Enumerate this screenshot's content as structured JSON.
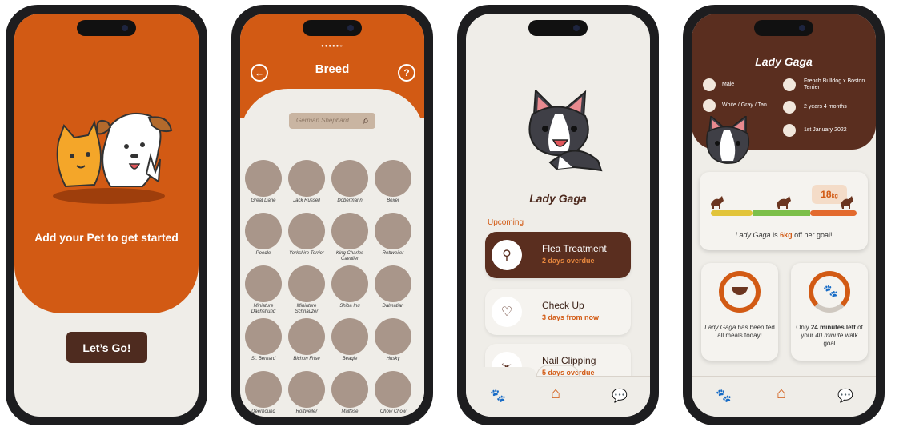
{
  "screen1": {
    "headline": "Add your Pet to get started",
    "cta_label": "Let’s Go!"
  },
  "screen2": {
    "pager": "●●●●●○",
    "title": "Breed",
    "back_icon": "arrow-left-icon",
    "help_icon": "question-icon",
    "help_glyph": "?",
    "back_glyph": "←",
    "search_placeholder": "German Shephard",
    "search_glyph": "⌕",
    "breeds": [
      "Great Dane",
      "Jack Russell",
      "Dobermann",
      "Boxer",
      "Poodle",
      "Yorkshire Terrier",
      "King Charles Cavalier",
      "Rottweiler",
      "Miniature Dachshund",
      "Miniature Schnauzer",
      "Shiba Inu",
      "Dalmatian",
      "St. Bernard",
      "Bichon Frise",
      "Beagle",
      "Husky",
      "Deerhound",
      "Rottweiler",
      "Maltese",
      "Chow Chow"
    ]
  },
  "screen3": {
    "pet_name": "Lady Gaga",
    "upcoming_label": "Upcoming",
    "tasks": [
      {
        "title": "Flea Treatment",
        "due": "2 days overdue",
        "icon": "flea-icon",
        "glyph": "⚲"
      },
      {
        "title": "Check Up",
        "due": "3 days from now",
        "icon": "heart-plus-icon",
        "glyph": "♡"
      },
      {
        "title": "Nail Clipping",
        "due": "5 days overdue",
        "icon": "clippers-icon",
        "glyph": "✂"
      }
    ],
    "nav": {
      "paw": "🐾",
      "home": "⌂",
      "chat": "💬"
    }
  },
  "screen4": {
    "pet_name": "Lady Gaga",
    "info": {
      "sex": "Male",
      "breed": "French Bulldog x Boston Terrier",
      "colour": "White / Gray / Tan",
      "age": "2 years 4 months",
      "birthday": "1st January 2022"
    },
    "weight": {
      "value": "18",
      "unit": "kg",
      "goal_name": "Lady Gaga",
      "goal_is": " is ",
      "goal_kg": "6kg",
      "goal_rest": " off her goal!"
    },
    "meals": {
      "name": "Lady Gaga",
      "rest": " has been fed all meals today!"
    },
    "walk": {
      "pre": "Only ",
      "minutes": "24 minutes",
      "left": " left",
      "mid": " of your ",
      "total": "40 minute",
      "post": " walk goal"
    },
    "colors": {
      "orange": "#d25a14",
      "brown": "#5a2e1f",
      "yellow": "#e2c43a",
      "green": "#7cbf4a"
    },
    "nav": {
      "paw": "🐾",
      "home": "⌂",
      "chat": "💬"
    }
  }
}
